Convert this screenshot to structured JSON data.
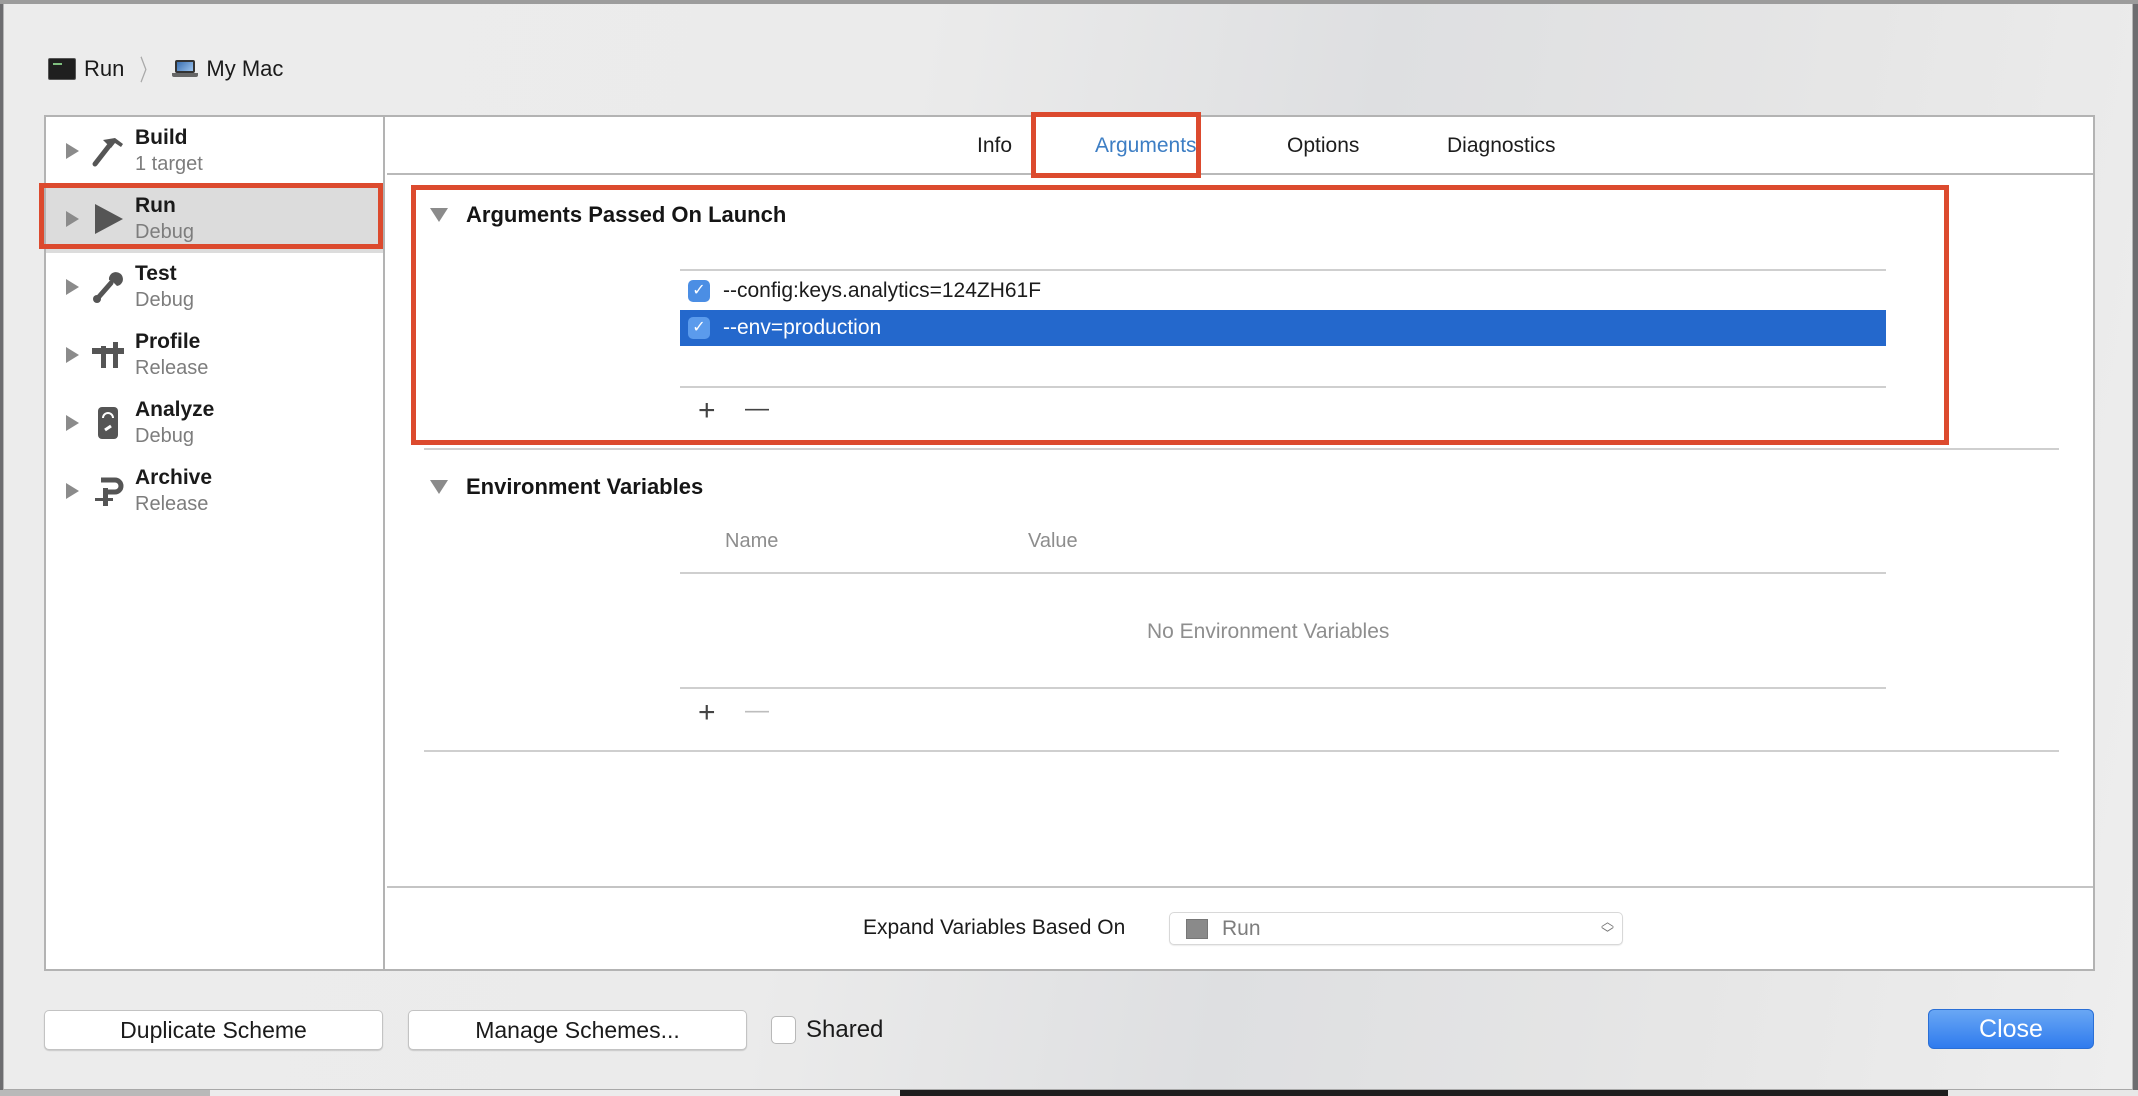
{
  "breadcrumb": {
    "scheme": "Run",
    "scheme_icon": "terminal-icon",
    "destination": "My Mac",
    "destination_icon": "laptop-icon"
  },
  "sidebar": {
    "items": [
      {
        "title": "Build",
        "subtitle": "1 target",
        "icon": "hammer-icon",
        "selected": false
      },
      {
        "title": "Run",
        "subtitle": "Debug",
        "icon": "play-icon",
        "selected": true
      },
      {
        "title": "Test",
        "subtitle": "Debug",
        "icon": "wrench-icon",
        "selected": false
      },
      {
        "title": "Profile",
        "subtitle": "Release",
        "icon": "caliper-icon",
        "selected": false
      },
      {
        "title": "Analyze",
        "subtitle": "Debug",
        "icon": "analyze-icon",
        "selected": false
      },
      {
        "title": "Archive",
        "subtitle": "Release",
        "icon": "clamp-icon",
        "selected": false
      }
    ]
  },
  "tabs": [
    {
      "label": "Info",
      "active": false
    },
    {
      "label": "Arguments",
      "active": true
    },
    {
      "label": "Options",
      "active": false
    },
    {
      "label": "Diagnostics",
      "active": false
    }
  ],
  "arguments_section": {
    "title": "Arguments Passed On Launch",
    "rows": [
      {
        "checked": true,
        "value": "--config:keys.analytics=124ZH61F",
        "selected": false
      },
      {
        "checked": true,
        "value": "--env=production",
        "selected": true
      }
    ],
    "add_label": "+",
    "remove_label": "—"
  },
  "env_section": {
    "title": "Environment Variables",
    "columns": [
      "Name",
      "Value"
    ],
    "empty_text": "No Environment Variables",
    "add_label": "+",
    "remove_label": "—"
  },
  "expand": {
    "label": "Expand Variables Based On",
    "selected": "Run"
  },
  "footer": {
    "duplicate_label": "Duplicate Scheme",
    "manage_label": "Manage Schemes...",
    "shared_label": "Shared",
    "shared_checked": false,
    "close_label": "Close"
  },
  "colors": {
    "accent": "#3d7ec4",
    "selection": "#2468cc",
    "highlight_box": "#dc4a2e",
    "close_button": "#2f7bee"
  }
}
